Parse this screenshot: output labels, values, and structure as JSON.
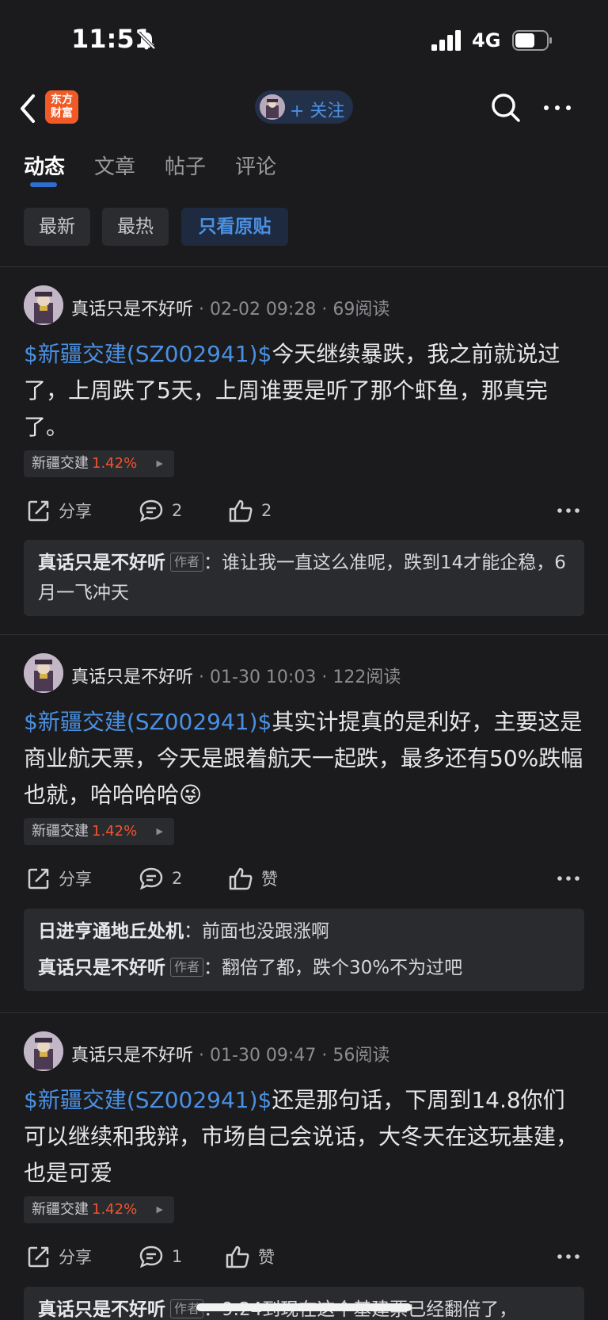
{
  "status_bar": {
    "time": "11:51",
    "network": "4G"
  },
  "nav": {
    "logo_text_line1": "东方",
    "logo_text_line2": "财富",
    "follow_label": "+ 关注"
  },
  "tabs": [
    {
      "label": "动态",
      "active": true
    },
    {
      "label": "文章",
      "active": false
    },
    {
      "label": "帖子",
      "active": false
    },
    {
      "label": "评论",
      "active": false
    }
  ],
  "filters": [
    {
      "label": "最新",
      "active": false
    },
    {
      "label": "最热",
      "active": false
    },
    {
      "label": "只看原贴",
      "active": true
    }
  ],
  "posts": [
    {
      "author": "真话只是不好听",
      "time": "02-02 09:28",
      "reads": "69阅读",
      "stock_link": "$新疆交建(SZ002941)$",
      "text": "今天继续暴跌，我之前就说过了，上周跌了5天，上周谁要是听了那个虾鱼，那真完了。",
      "tag_name": "新疆交建",
      "tag_pct": "1.42%",
      "share": "分享",
      "comments": "2",
      "likes": "2",
      "replies": [
        {
          "name": "真话只是不好听",
          "is_author": true,
          "badge": "作者",
          "text": "谁让我一直这么准呢，跌到14才能企稳，6月一飞冲天"
        }
      ]
    },
    {
      "author": "真话只是不好听",
      "time": "01-30 10:03",
      "reads": "122阅读",
      "stock_link": "$新疆交建(SZ002941)$",
      "text": "其实计提真的是利好，主要这是商业航天票，今天是跟着航天一起跌，最多还有50%跌幅也就，哈哈哈哈😜",
      "tag_name": "新疆交建",
      "tag_pct": "1.42%",
      "share": "分享",
      "comments": "2",
      "likes": "赞",
      "replies": [
        {
          "name": "日进亨通地丘处机",
          "is_author": false,
          "badge": "",
          "text": "前面也没跟涨啊"
        },
        {
          "name": "真话只是不好听",
          "is_author": true,
          "badge": "作者",
          "text": "翻倍了都，跌个30%不为过吧"
        }
      ]
    },
    {
      "author": "真话只是不好听",
      "time": "01-30 09:47",
      "reads": "56阅读",
      "stock_link": "$新疆交建(SZ002941)$",
      "text": "还是那句话，下周到14.8你们可以继续和我辩，市场自己会说话，大冬天在这玩基建，也是可爱",
      "tag_name": "新疆交建",
      "tag_pct": "1.42%",
      "share": "分享",
      "comments": "1",
      "likes": "赞",
      "replies": [
        {
          "name": "真话只是不好听",
          "is_author": true,
          "badge": "作者",
          "text": "9.24到现在这个基建票已经翻倍了，"
        }
      ]
    }
  ],
  "colors": {
    "background": "#1b1b1d",
    "accent_blue": "#4a90e2",
    "stock_up": "#f0532f",
    "logo": "#ef5a27"
  }
}
